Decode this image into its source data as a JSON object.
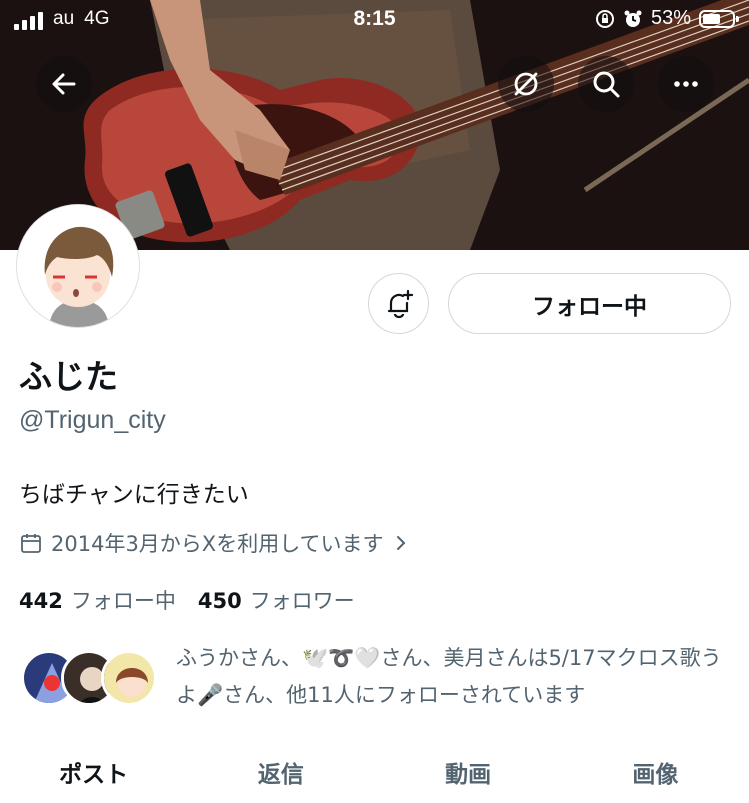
{
  "status_bar": {
    "carrier": "au",
    "network": "4G",
    "time": "8:15",
    "battery_percent": "53%",
    "battery_level": 0.53
  },
  "header": {
    "back_icon": "arrow-left-icon",
    "actions": [
      "grok-icon",
      "search-icon",
      "more-icon"
    ]
  },
  "profile": {
    "display_name": "ふじた",
    "handle": "@Trigun_city",
    "bio": "ちばチャンに行きたい",
    "joined": "2014年3月からXを利用しています",
    "notify_icon": "bell-plus-icon",
    "follow_label": "フォロー中"
  },
  "stats": {
    "following_count": "442",
    "following_label": "フォロー中",
    "followers_count": "450",
    "followers_label": "フォロワー"
  },
  "followed_by": {
    "text": "ふうかさん、🕊️➰🤍さん、美月さんは5/17マクロス歌うよ🎤さん、他11人にフォローされています"
  },
  "tabs": [
    {
      "label": "ポスト",
      "active": true
    },
    {
      "label": "返信",
      "active": false
    },
    {
      "label": "動画",
      "active": false
    },
    {
      "label": "画像",
      "active": false
    }
  ],
  "colors": {
    "text_primary": "#0f1419",
    "text_secondary": "#536471",
    "border": "#cfd9de"
  }
}
